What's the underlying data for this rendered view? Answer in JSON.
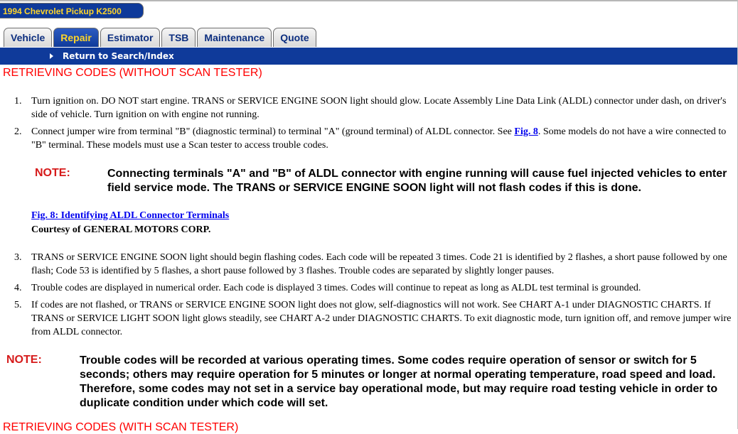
{
  "vehicle_title": "1994 Chevrolet Pickup K2500",
  "tabs": [
    {
      "label": "Vehicle"
    },
    {
      "label": "Repair"
    },
    {
      "label": "Estimator"
    },
    {
      "label": "TSB"
    },
    {
      "label": "Maintenance"
    },
    {
      "label": "Quote"
    }
  ],
  "active_tab": "Repair",
  "nav_link": "Return to Search/Index",
  "section_heading": "RETRIEVING CODES (WITHOUT SCAN TESTER)",
  "steps": [
    {
      "num": "1.",
      "text": "Turn ignition on. DO NOT start engine. TRANS or SERVICE ENGINE SOON light should glow. Locate Assembly Line Data Link (ALDL) connector under dash, on driver's side of vehicle. Turn ignition on with engine not running."
    },
    {
      "num": "2.",
      "text_before": "Connect jumper wire from terminal \"B\" (diagnostic terminal) to terminal \"A\" (ground terminal) of ALDL connector. See ",
      "link": "Fig. 8",
      "text_after": ". Some models do not have a wire connected to \"B\" terminal. These models must use a Scan tester to access trouble codes."
    },
    {
      "num": "3.",
      "text": "TRANS or SERVICE ENGINE SOON light should begin flashing codes. Each code will be repeated 3 times. Code 21 is identified by 2 flashes, a short pause followed by one flash; Code 53 is identified by 5 flashes, a short pause followed by 3 flashes. Trouble codes are separated by slightly longer pauses."
    },
    {
      "num": "4.",
      "text": "Trouble codes are displayed in numerical order. Each code is displayed 3 times. Codes will continue to repeat as long as ALDL test terminal is grounded."
    },
    {
      "num": "5.",
      "text": "If codes are not flashed, or TRANS or SERVICE ENGINE SOON light does not glow, self-diagnostics will not work. See CHART A-1 under DIAGNOSTIC CHARTS. If TRANS or SERVICE LIGHT SOON light glows steadily, see CHART A-2 under DIAGNOSTIC CHARTS. To exit diagnostic mode, turn ignition off, and remove jumper wire from ALDL connector."
    }
  ],
  "note1": {
    "label": "NOTE:",
    "text": "Connecting terminals \"A\" and \"B\" of ALDL connector with engine running will cause fuel injected vehicles to enter field service mode. The TRANS or SERVICE ENGINE SOON light will not flash codes if this is done."
  },
  "figure": {
    "link": "Fig. 8: Identifying ALDL Connector Terminals",
    "courtesy": "Courtesy of GENERAL MOTORS CORP."
  },
  "note2": {
    "label": "NOTE:",
    "text": "Trouble codes will be recorded at various operating times. Some codes require operation of sensor or switch for 5 seconds; others may require operation for 5 minutes or longer at normal operating temperature, road speed and load. Therefore, some codes may not set in a service bay operational mode, but may require road testing vehicle in order to duplicate condition under which code will set."
  },
  "next_heading": "RETRIEVING CODES (WITH SCAN TESTER)",
  "colors": {
    "nav_blue": "#0f3a9a",
    "tab_active_text": "#ffd52a",
    "heading_red": "#ff0000",
    "note_red": "#d61a1a"
  }
}
